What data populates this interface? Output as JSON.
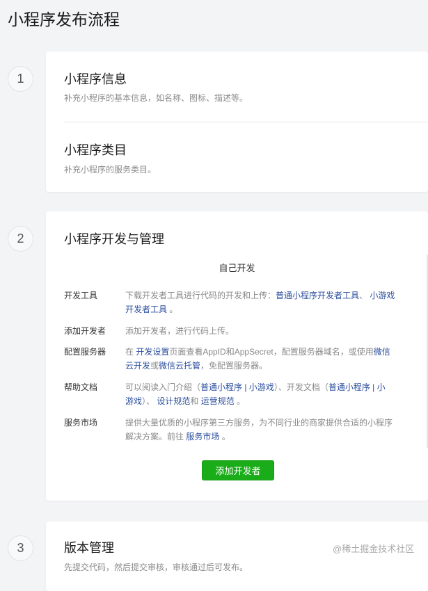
{
  "page_title": "小程序发布流程",
  "steps": [
    {
      "num": "1"
    },
    {
      "num": "2"
    },
    {
      "num": "3"
    }
  ],
  "step1": {
    "info": {
      "title": "小程序信息",
      "desc": "补充小程序的基本信息，如名称、图标、描述等。"
    },
    "category": {
      "title": "小程序类目",
      "desc": "补充小程序的服务类目。"
    }
  },
  "step2": {
    "title": "小程序开发与管理",
    "subtitle": "自己开发",
    "rows": {
      "tools": {
        "label": "开发工具",
        "text1": "下载开发者工具进行代码的开发和上传：",
        "link1": "普通小程序开发者工具",
        "sep1": "、",
        "link2": "小游戏",
        "link3": "开发者工具",
        "end": "。"
      },
      "devs": {
        "label": "添加开发者",
        "text": "添加开发者，进行代码上传。"
      },
      "server": {
        "label": "配置服务器",
        "t1": "在",
        "link1": "开发设置",
        "t2": "页面查看AppID和AppSecret，配置服务器域名，或使用",
        "link2": "微信",
        "link3": "云开发",
        "t3": "或",
        "link4": "微信云托管",
        "t4": "，免配置服务器。"
      },
      "docs": {
        "label": "帮助文档",
        "t1": "可以阅读入门介绍（",
        "l1": "普通小程序 | 小游戏",
        "t2": "）、开发文档（",
        "l2": "普通小程序 | 小",
        "l3": "游戏",
        "t3": "）、",
        "l4": "设计规范",
        "t4": "和",
        "l5": "运营规范",
        "t5": "。"
      },
      "market": {
        "label": "服务市场",
        "t1": "提供大量优质的小程序第三方服务，为不同行业的商家提供合适的小程序",
        "t2": "解决方案。前往",
        "link": "服务市场",
        "t3": "。"
      }
    },
    "button": "添加开发者"
  },
  "step3": {
    "title": "版本管理",
    "desc": "先提交代码，然后提交审核，审核通过后可发布。"
  },
  "watermark": "@稀土掘金技术社区"
}
